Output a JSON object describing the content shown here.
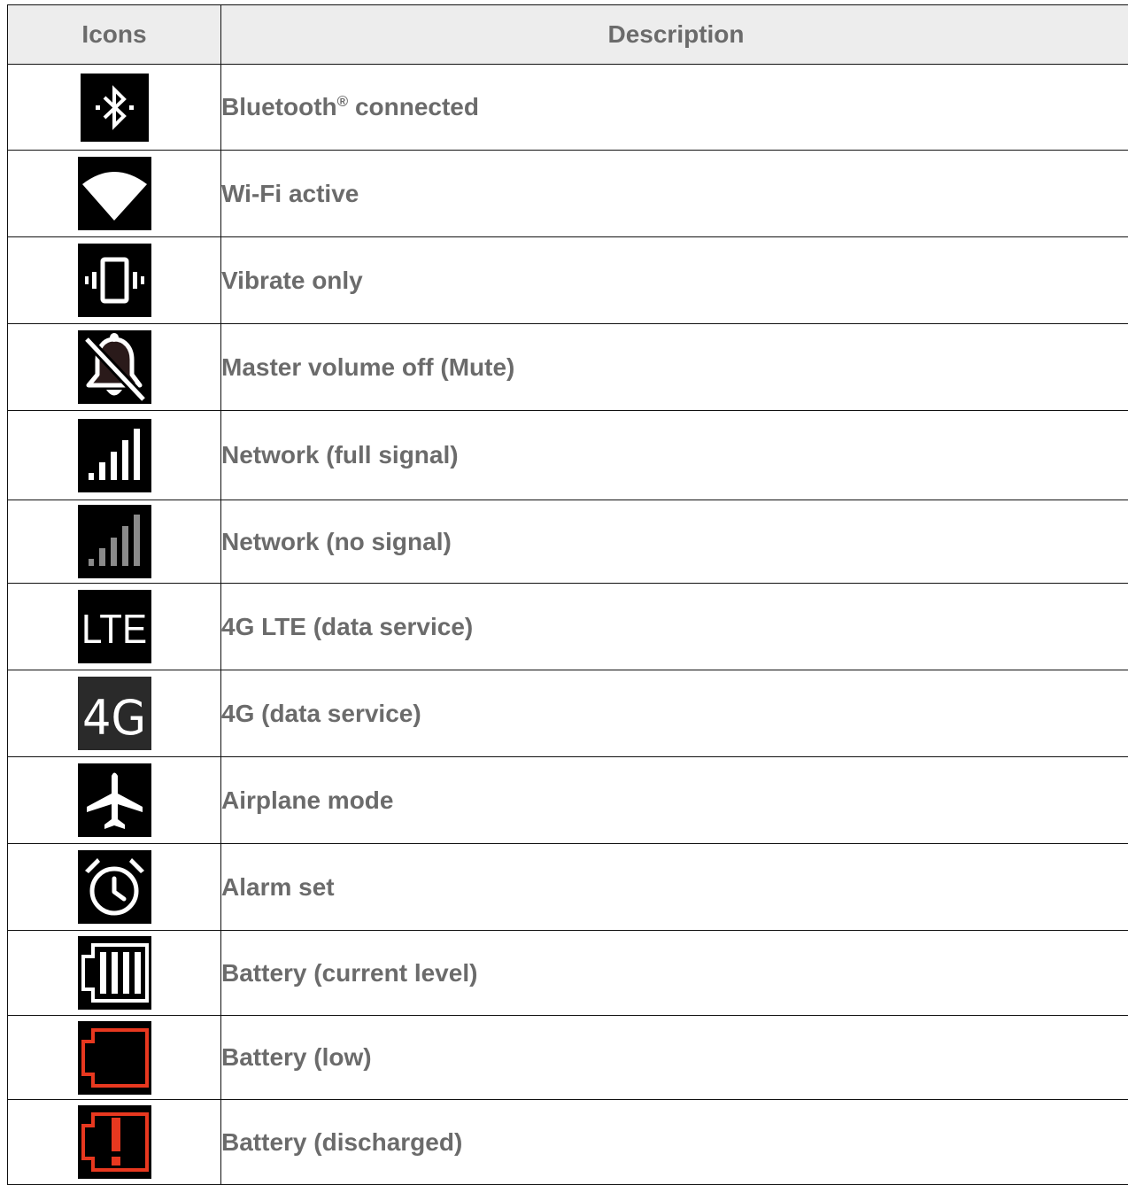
{
  "table": {
    "headers": {
      "icons": "Icons",
      "description": "Description"
    },
    "rows": [
      {
        "icon": "bluetooth-icon",
        "description": "Bluetooth",
        "sup": "®",
        "description_suffix": " connected"
      },
      {
        "icon": "wifi-icon",
        "description": "Wi-Fi active"
      },
      {
        "icon": "vibrate-icon",
        "description": "Vibrate only"
      },
      {
        "icon": "mute-bell-icon",
        "description": "Master volume off (Mute)"
      },
      {
        "icon": "signal-full-icon",
        "description": "Network (full signal)"
      },
      {
        "icon": "signal-none-icon",
        "description": "Network (no signal)"
      },
      {
        "icon": "lte-icon",
        "icon_text": "LTE",
        "description": "4G LTE (data service)"
      },
      {
        "icon": "4g-icon",
        "icon_text": "4G",
        "description": "4G (data service)"
      },
      {
        "icon": "airplane-icon",
        "description": "Airplane mode"
      },
      {
        "icon": "alarm-icon",
        "description": "Alarm set"
      },
      {
        "icon": "battery-full-icon",
        "description": "Battery (current level)"
      },
      {
        "icon": "battery-low-icon",
        "description": "Battery (low)"
      },
      {
        "icon": "battery-discharged-icon",
        "description": "Battery (discharged)"
      }
    ]
  },
  "colors": {
    "header_bg": "#ededed",
    "text": "#6b6b6b",
    "battery_alert": "#e8381f",
    "signal_off": "#8a8a8a"
  }
}
